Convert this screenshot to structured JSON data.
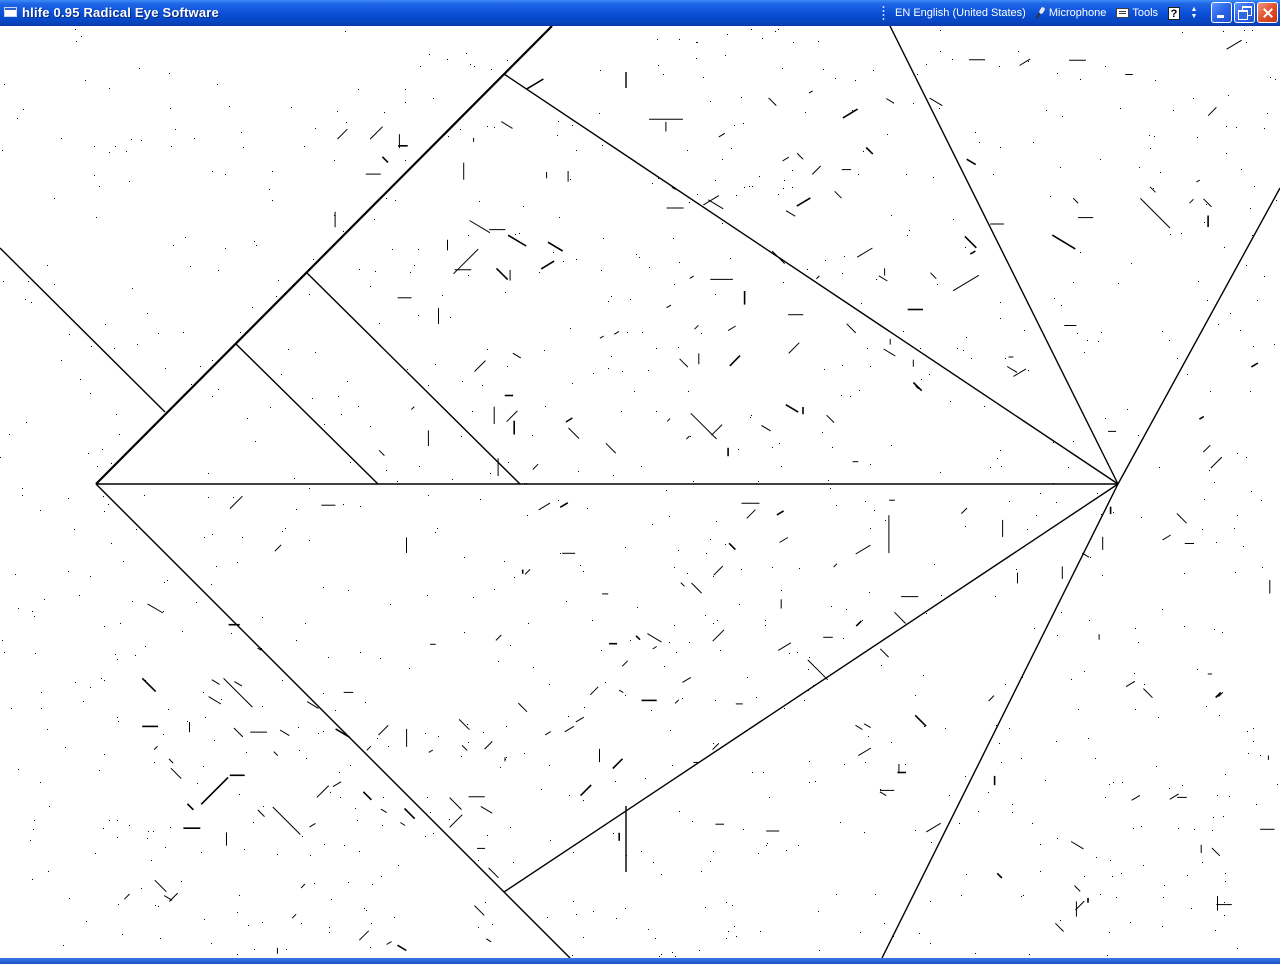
{
  "window": {
    "title": "hlife 0.95 Radical Eye Software"
  },
  "language_bar": {
    "language": "EN English (United States)",
    "microphone_label": "Microphone",
    "tools_label": "Tools",
    "help_label": "?",
    "options_label": "⌃⌄"
  },
  "window_controls": {
    "minimize_icon": "minimize-icon",
    "maximize_icon": "restore-icon",
    "close_icon": "close-icon"
  },
  "canvas": {
    "background_color": "#ffffff",
    "cell_color": "#000000"
  },
  "colors": {
    "titlebar_blue": "#0a4fd6",
    "close_red": "#e0502a"
  }
}
